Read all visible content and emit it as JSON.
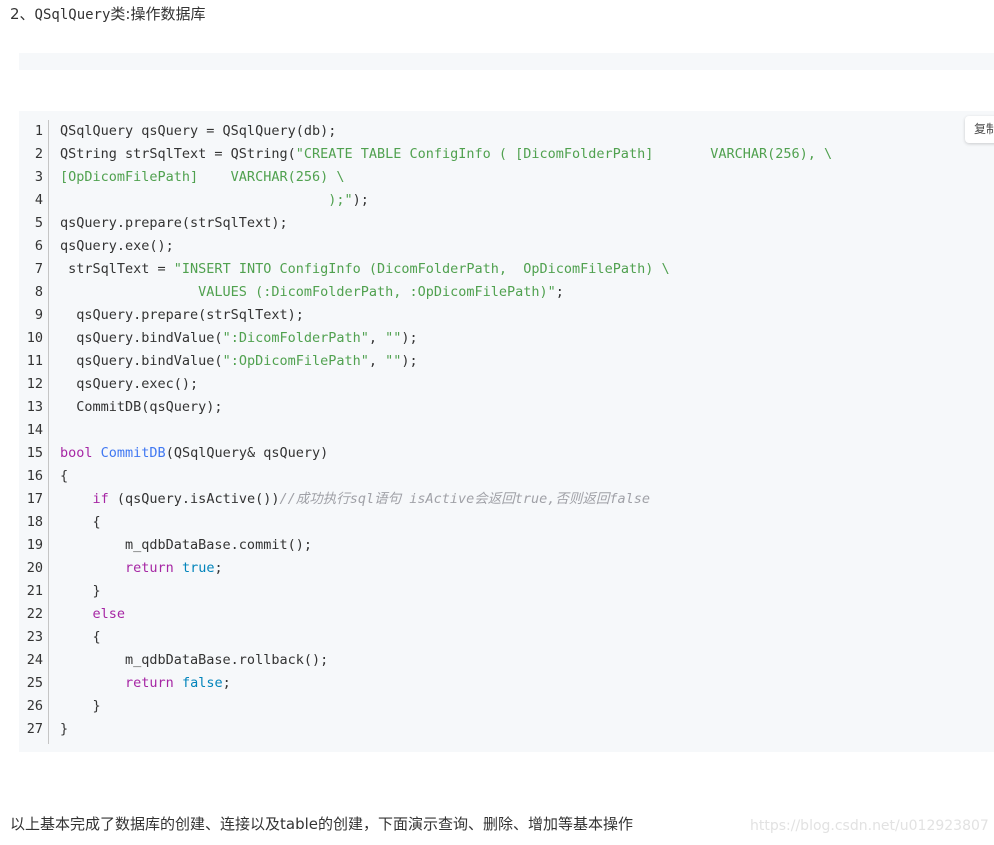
{
  "heading": {
    "prefix": "2、",
    "code": "QSqlQuery",
    "suffix": "类:操作数据库"
  },
  "copy_button": {
    "label": "复制"
  },
  "code_lines": [
    {
      "n": "1",
      "tokens": [
        {
          "t": "QSqlQuery qsQuery = QSqlQuery(db);"
        }
      ]
    },
    {
      "n": "2",
      "tokens": [
        {
          "t": "QString strSqlText = QString("
        },
        {
          "t": "\"CREATE TABLE ConfigInfo ( [DicomFolderPath]       VARCHAR(256), \\",
          "c": "str"
        }
      ]
    },
    {
      "n": "3",
      "tokens": [
        {
          "t": "[OpDicomFilePath]    VARCHAR(256) \\",
          "c": "str"
        }
      ]
    },
    {
      "n": "4",
      "tokens": [
        {
          "t": "                                 );\"",
          "c": "str"
        },
        {
          "t": ");"
        }
      ]
    },
    {
      "n": "5",
      "tokens": [
        {
          "t": "qsQuery.prepare(strSqlText);"
        }
      ]
    },
    {
      "n": "6",
      "tokens": [
        {
          "t": "qsQuery.exe();"
        }
      ]
    },
    {
      "n": "7",
      "tokens": [
        {
          "t": " strSqlText = "
        },
        {
          "t": "\"INSERT INTO ConfigInfo (DicomFolderPath,  OpDicomFilePath) \\",
          "c": "str"
        }
      ]
    },
    {
      "n": "8",
      "tokens": [
        {
          "t": "                 VALUES (:DicomFolderPath, :OpDicomFilePath)\"",
          "c": "str"
        },
        {
          "t": ";"
        }
      ]
    },
    {
      "n": "9",
      "tokens": [
        {
          "t": "  qsQuery.prepare(strSqlText);"
        }
      ]
    },
    {
      "n": "10",
      "tokens": [
        {
          "t": "  qsQuery.bindValue("
        },
        {
          "t": "\":DicomFolderPath\"",
          "c": "str"
        },
        {
          "t": ", "
        },
        {
          "t": "\"\"",
          "c": "str"
        },
        {
          "t": ");"
        }
      ]
    },
    {
      "n": "11",
      "tokens": [
        {
          "t": "  qsQuery.bindValue("
        },
        {
          "t": "\":OpDicomFilePath\"",
          "c": "str"
        },
        {
          "t": ", "
        },
        {
          "t": "\"\"",
          "c": "str"
        },
        {
          "t": ");"
        }
      ]
    },
    {
      "n": "12",
      "tokens": [
        {
          "t": "  qsQuery.exec();"
        }
      ]
    },
    {
      "n": "13",
      "tokens": [
        {
          "t": "  CommitDB(qsQuery);"
        }
      ]
    },
    {
      "n": "14",
      "tokens": [
        {
          "t": ""
        }
      ]
    },
    {
      "n": "15",
      "tokens": [
        {
          "t": "bool",
          "c": "kw"
        },
        {
          "t": " "
        },
        {
          "t": "CommitDB",
          "c": "fn"
        },
        {
          "t": "(QSqlQuery& qsQuery)"
        }
      ]
    },
    {
      "n": "16",
      "tokens": [
        {
          "t": "{"
        }
      ]
    },
    {
      "n": "17",
      "tokens": [
        {
          "t": "    "
        },
        {
          "t": "if",
          "c": "kw"
        },
        {
          "t": " (qsQuery.isActive())"
        },
        {
          "t": "//成功执行sql语句 isActive会返回true,否则返回false",
          "c": "com"
        }
      ]
    },
    {
      "n": "18",
      "tokens": [
        {
          "t": "    {"
        }
      ]
    },
    {
      "n": "19",
      "tokens": [
        {
          "t": "        m_qdbDataBase.commit();"
        }
      ]
    },
    {
      "n": "20",
      "tokens": [
        {
          "t": "        "
        },
        {
          "t": "return",
          "c": "kw"
        },
        {
          "t": " "
        },
        {
          "t": "true",
          "c": "lit"
        },
        {
          "t": ";"
        }
      ]
    },
    {
      "n": "21",
      "tokens": [
        {
          "t": "    }"
        }
      ]
    },
    {
      "n": "22",
      "tokens": [
        {
          "t": "    "
        },
        {
          "t": "else",
          "c": "kw"
        }
      ]
    },
    {
      "n": "23",
      "tokens": [
        {
          "t": "    {"
        }
      ]
    },
    {
      "n": "24",
      "tokens": [
        {
          "t": "        m_qdbDataBase.rollback();"
        }
      ]
    },
    {
      "n": "25",
      "tokens": [
        {
          "t": "        "
        },
        {
          "t": "return",
          "c": "kw"
        },
        {
          "t": " "
        },
        {
          "t": "false",
          "c": "lit"
        },
        {
          "t": ";"
        }
      ]
    },
    {
      "n": "26",
      "tokens": [
        {
          "t": "    }"
        }
      ]
    },
    {
      "n": "27",
      "tokens": [
        {
          "t": "}"
        }
      ]
    }
  ],
  "footer": {
    "text": "以上基本完成了数据库的创建、连接以及table的创建，下面演示查询、删除、增加等基本操作"
  },
  "watermark": {
    "text": "https://blog.csdn.net/u012923807"
  },
  "colors": {
    "code_background": "#f6f8fa",
    "string": "#50a14f",
    "keyword": "#a626a4",
    "function": "#4078f2",
    "literal": "#0184bb",
    "comment": "#a0a1a7"
  }
}
